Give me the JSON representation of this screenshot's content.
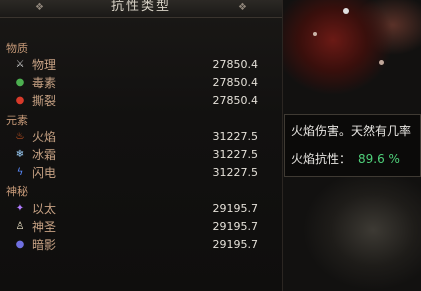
{
  "panel": {
    "title": "抗性类型",
    "categories": [
      {
        "label": "物质",
        "items": [
          {
            "name": "物理",
            "value": "27850.4",
            "icon": "sword-icon",
            "color": "#c8c8c8"
          },
          {
            "name": "毒素",
            "value": "27850.4",
            "icon": "poison-icon",
            "color": "#4caf50"
          },
          {
            "name": "撕裂",
            "value": "27850.4",
            "icon": "bleed-icon",
            "color": "#d83a2a"
          }
        ]
      },
      {
        "label": "元素",
        "items": [
          {
            "name": "火焰",
            "value": "31227.5",
            "icon": "fire-icon",
            "color": "#ff6a2a"
          },
          {
            "name": "冰霜",
            "value": "31227.5",
            "icon": "frost-icon",
            "color": "#9fd3ff"
          },
          {
            "name": "闪电",
            "value": "31227.5",
            "icon": "lightning-icon",
            "color": "#5a8cff"
          }
        ]
      },
      {
        "label": "神秘",
        "items": [
          {
            "name": "以太",
            "value": "29195.7",
            "icon": "aether-icon",
            "color": "#b07cff"
          },
          {
            "name": "神圣",
            "value": "29195.7",
            "icon": "holy-icon",
            "color": "#f0e6c8"
          },
          {
            "name": "暗影",
            "value": "29195.7",
            "icon": "shadow-icon",
            "color": "#6f6fe0"
          }
        ]
      }
    ]
  },
  "tooltip": {
    "description": "火焰伤害。天然有几率",
    "label": "火焰抗性：",
    "value": "89.6 %"
  }
}
